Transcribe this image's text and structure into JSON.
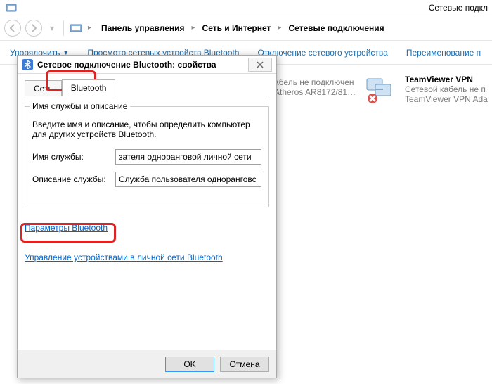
{
  "window": {
    "title_partial": "Сетевые подкл"
  },
  "breadcrumb": {
    "items": [
      "Панель управления",
      "Сеть и Интернет",
      "Сетевые подключения"
    ]
  },
  "toolbar": {
    "organize": "Упорядочить",
    "view_bt": "Просмотр сетевых устройств Bluetooth",
    "disable": "Отключение сетевого устройства",
    "rename": "Переименование п"
  },
  "connections": {
    "item0": {
      "line1_partial": "абель не подключен",
      "line2_partial": "Atheros AR8172/81…"
    },
    "item1": {
      "line1": "TeamViewer VPN",
      "line2_partial": "Сетевой кабель не п",
      "line3_partial": "TeamViewer VPN Ada"
    }
  },
  "dialog": {
    "title": "Сетевое подключение Bluetooth: свойства",
    "tabs": {
      "net": "Сеть",
      "bt": "Bluetooth"
    },
    "group": {
      "legend": "Имя службы и описание",
      "descr": "Введите имя и описание, чтобы определить компьютер для других устройств Bluetooth.",
      "name_label": "Имя службы:",
      "name_value": "зателя одноранговой личной сети",
      "desc_label": "Описание службы:",
      "desc_value": "Служба пользователя одноранговс"
    },
    "link1": "Параметры Bluetooth",
    "link2": "Управление устройствами в личной сети Bluetooth",
    "ok": "OK",
    "cancel": "Отмена"
  }
}
